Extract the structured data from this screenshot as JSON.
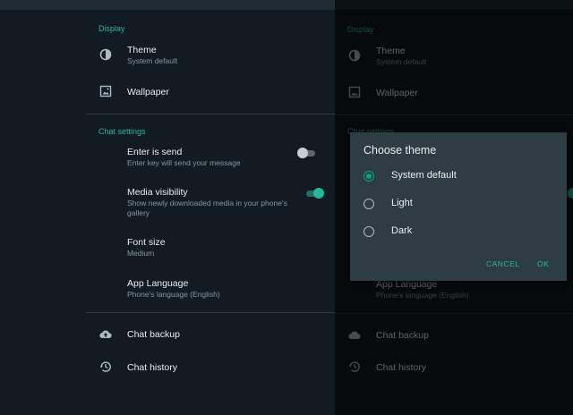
{
  "colors": {
    "accent": "#25b79f",
    "background": "#121b22",
    "panel": "#121b22",
    "dialog": "#2e3d43"
  },
  "settings": {
    "display_header": "Display",
    "theme": {
      "title": "Theme",
      "subtitle": "System default",
      "icon": "theme-icon"
    },
    "wallpaper": {
      "title": "Wallpaper",
      "icon": "wallpaper-icon"
    },
    "chat_settings_header": "Chat settings",
    "enter_is_send": {
      "title": "Enter is send",
      "subtitle": "Enter key will send your message",
      "enabled": false
    },
    "media_visibility": {
      "title": "Media visibility",
      "subtitle_line1": "Show newly downloaded media in your phone's",
      "subtitle_line2": "gallery",
      "enabled": true
    },
    "font_size": {
      "title": "Font size",
      "subtitle": "Medium"
    },
    "app_language": {
      "title": "App Language",
      "subtitle": "Phone's language (English)"
    },
    "chat_backup": {
      "title": "Chat backup",
      "icon": "cloud-upload-icon"
    },
    "chat_history": {
      "title": "Chat history",
      "icon": "history-icon"
    }
  },
  "dialog": {
    "title": "Choose theme",
    "options": [
      {
        "label": "System default",
        "selected": true
      },
      {
        "label": "Light",
        "selected": false
      },
      {
        "label": "Dark",
        "selected": false
      }
    ],
    "cancel": "CANCEL",
    "ok": "OK"
  }
}
